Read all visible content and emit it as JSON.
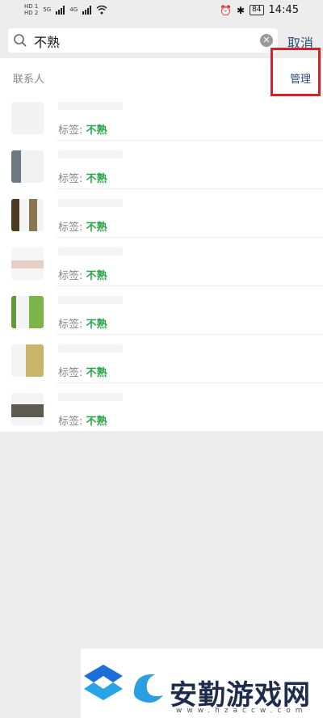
{
  "status_bar": {
    "sim1": "HD 1",
    "sim2": "HD 2",
    "network1": "5G",
    "network2": "4G",
    "battery": "84",
    "time": "14:45"
  },
  "search": {
    "query": "不熟",
    "cancel_label": "取消"
  },
  "section": {
    "title": "联系人",
    "manage_label": "管理"
  },
  "contacts": [
    {
      "tag_label": "标签:",
      "tag_value": "不熟"
    },
    {
      "tag_label": "标签:",
      "tag_value": "不熟"
    },
    {
      "tag_label": "标签:",
      "tag_value": "不熟"
    },
    {
      "tag_label": "标签:",
      "tag_value": "不熟"
    },
    {
      "tag_label": "标签:",
      "tag_value": "不熟"
    },
    {
      "tag_label": "标签:",
      "tag_value": "不熟"
    },
    {
      "tag_label": "标签:",
      "tag_value": "不熟"
    }
  ],
  "watermark": {
    "brand": "安勤游戏网",
    "domain": "www.hzaccw.com"
  },
  "colors": {
    "background": "#ededed",
    "link": "#2d4e78",
    "tag_green": "#2aa54a",
    "highlight_red": "#d3222a"
  }
}
